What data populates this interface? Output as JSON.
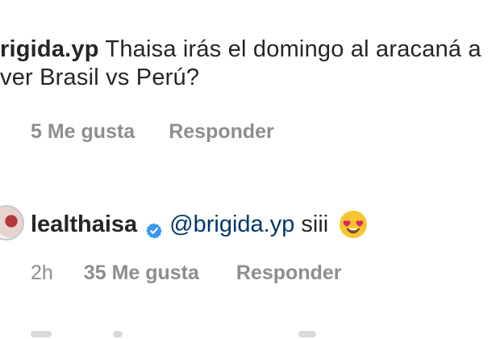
{
  "comments": [
    {
      "username": "rigida.yp",
      "text": " Thaisa irás el domingo al aracaná a ver Brasil vs Perú?",
      "likes": "5 Me gusta",
      "reply": "Responder"
    },
    {
      "username": "lealthaisa",
      "mention": "@brigida.yp",
      "text": "siii",
      "time": "2h",
      "likes": "35 Me gusta",
      "reply": "Responder",
      "emoji": "heart-eyes-emoji"
    }
  ],
  "colors": {
    "text": "#262626",
    "meta": "#8e8e8e",
    "mention": "#00376b",
    "verified": "#3897f0",
    "emoji": "#f7c531",
    "heart": "#e0245e"
  }
}
